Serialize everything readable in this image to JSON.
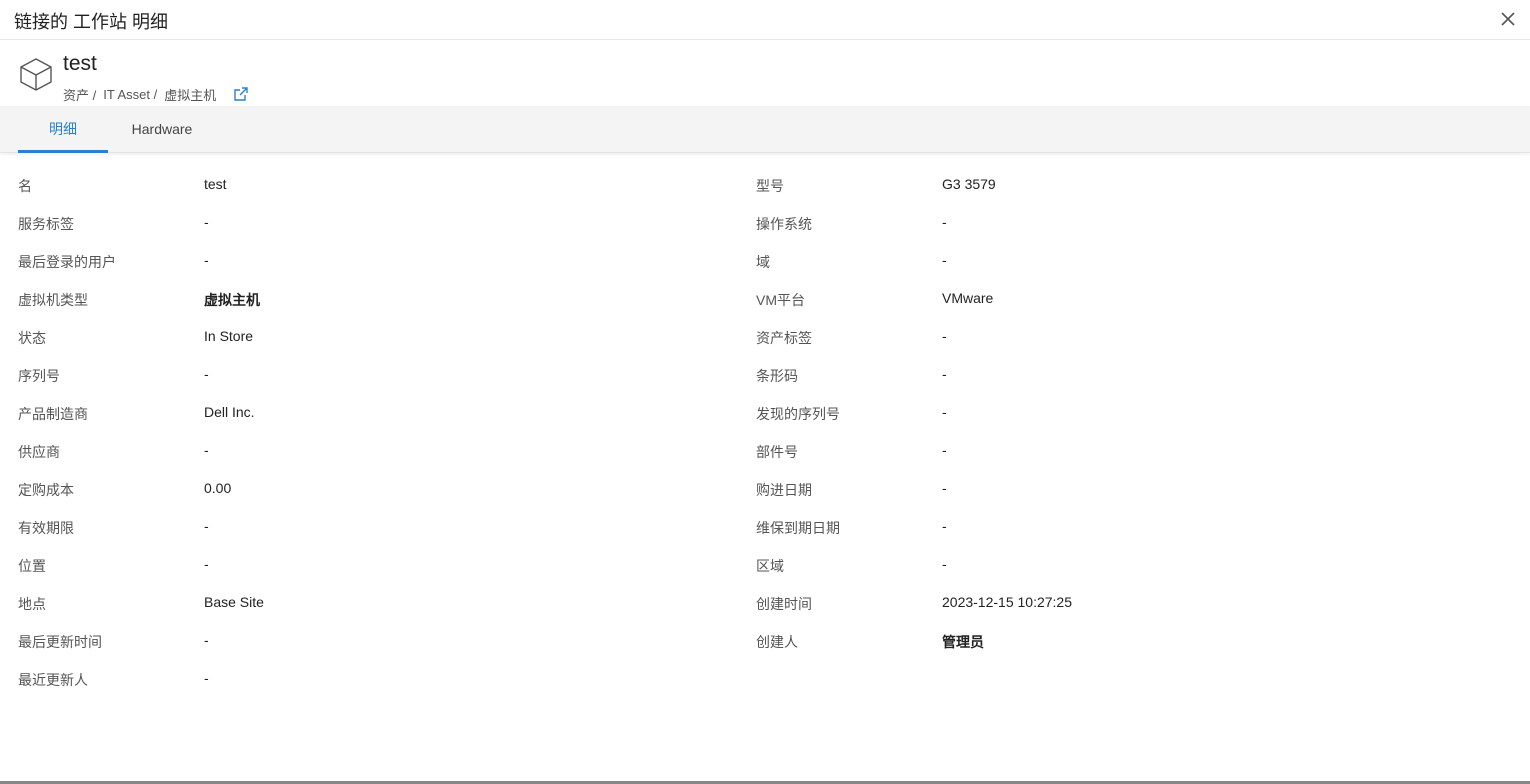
{
  "dialog": {
    "title": "链接的 工作站 明细"
  },
  "asset": {
    "name": "test",
    "breadcrumb": [
      "资产 /",
      "IT Asset /",
      "虚拟主机"
    ]
  },
  "tabs": [
    {
      "label": "明细",
      "active": true
    },
    {
      "label": "Hardware",
      "active": false
    }
  ],
  "details_left": [
    {
      "label": "名",
      "value": "test",
      "bold": false
    },
    {
      "label": "服务标签",
      "value": "-",
      "bold": false
    },
    {
      "label": "最后登录的用户",
      "value": "-",
      "bold": false
    },
    {
      "label": "虚拟机类型",
      "value": "虚拟主机",
      "bold": true
    },
    {
      "label": "状态",
      "value": "In Store",
      "bold": false
    },
    {
      "label": "序列号",
      "value": "-",
      "bold": false
    },
    {
      "label": "产品制造商",
      "value": "Dell Inc.",
      "bold": false
    },
    {
      "label": "供应商",
      "value": "-",
      "bold": false
    },
    {
      "label": "定购成本",
      "value": "0.00",
      "bold": false
    },
    {
      "label": "有效期限",
      "value": "-",
      "bold": false
    },
    {
      "label": "位置",
      "value": "-",
      "bold": false
    },
    {
      "label": "地点",
      "value": "Base Site",
      "bold": false
    },
    {
      "label": "最后更新时间",
      "value": "-",
      "bold": false
    },
    {
      "label": "最近更新人",
      "value": "-",
      "bold": false
    }
  ],
  "details_right": [
    {
      "label": "型号",
      "value": "G3 3579",
      "bold": false
    },
    {
      "label": "操作系统",
      "value": "-",
      "bold": false
    },
    {
      "label": "域",
      "value": "-",
      "bold": false
    },
    {
      "label": "VM平台",
      "value": "VMware",
      "bold": false
    },
    {
      "label": "资产标签",
      "value": "-",
      "bold": false
    },
    {
      "label": "条形码",
      "value": "-",
      "bold": false
    },
    {
      "label": "发现的序列号",
      "value": "-",
      "bold": false
    },
    {
      "label": "部件号",
      "value": "-",
      "bold": false
    },
    {
      "label": "购进日期",
      "value": "-",
      "bold": false
    },
    {
      "label": "维保到期日期",
      "value": "-",
      "bold": false
    },
    {
      "label": "区域",
      "value": "-",
      "bold": false
    },
    {
      "label": "创建时间",
      "value": "2023-12-15 10:27:25",
      "bold": false
    },
    {
      "label": "创建人",
      "value": "管理员",
      "bold": true
    }
  ],
  "icons": {
    "close": "close-icon",
    "asset": "cube-icon",
    "external": "external-link-icon"
  },
  "colors": {
    "accent": "#2a7fd4",
    "tab_bar": "#f4f4f4"
  }
}
